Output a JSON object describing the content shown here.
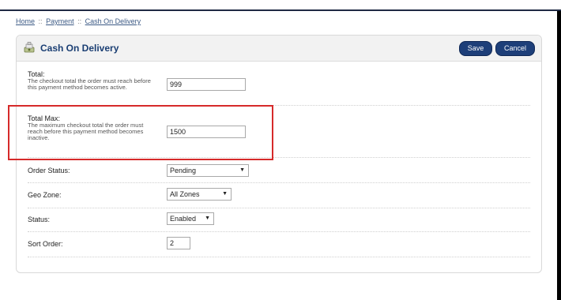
{
  "breadcrumb": {
    "items": [
      "Home",
      "Payment",
      "Cash On Delivery"
    ],
    "separator": "::"
  },
  "header": {
    "title": "Cash On Delivery",
    "save_label": "Save",
    "cancel_label": "Cancel",
    "icon": "payment-icon"
  },
  "form": {
    "total": {
      "label": "Total:",
      "help": "The checkout total the order must reach before this payment method becomes active.",
      "value": "999"
    },
    "total_max": {
      "label": "Total Max:",
      "help": "The maximum checkout total the order must reach before this payment method becomes inactive.",
      "value": "1500"
    },
    "order_status": {
      "label": "Order Status:",
      "value": "Pending"
    },
    "geo_zone": {
      "label": "Geo Zone:",
      "value": "All Zones"
    },
    "status": {
      "label": "Status:",
      "value": "Enabled"
    },
    "sort_order": {
      "label": "Sort Order:",
      "value": "2"
    }
  },
  "colors": {
    "accent": "#1e3f79",
    "title": "#1a3e73",
    "highlight": "#d62a2a"
  }
}
